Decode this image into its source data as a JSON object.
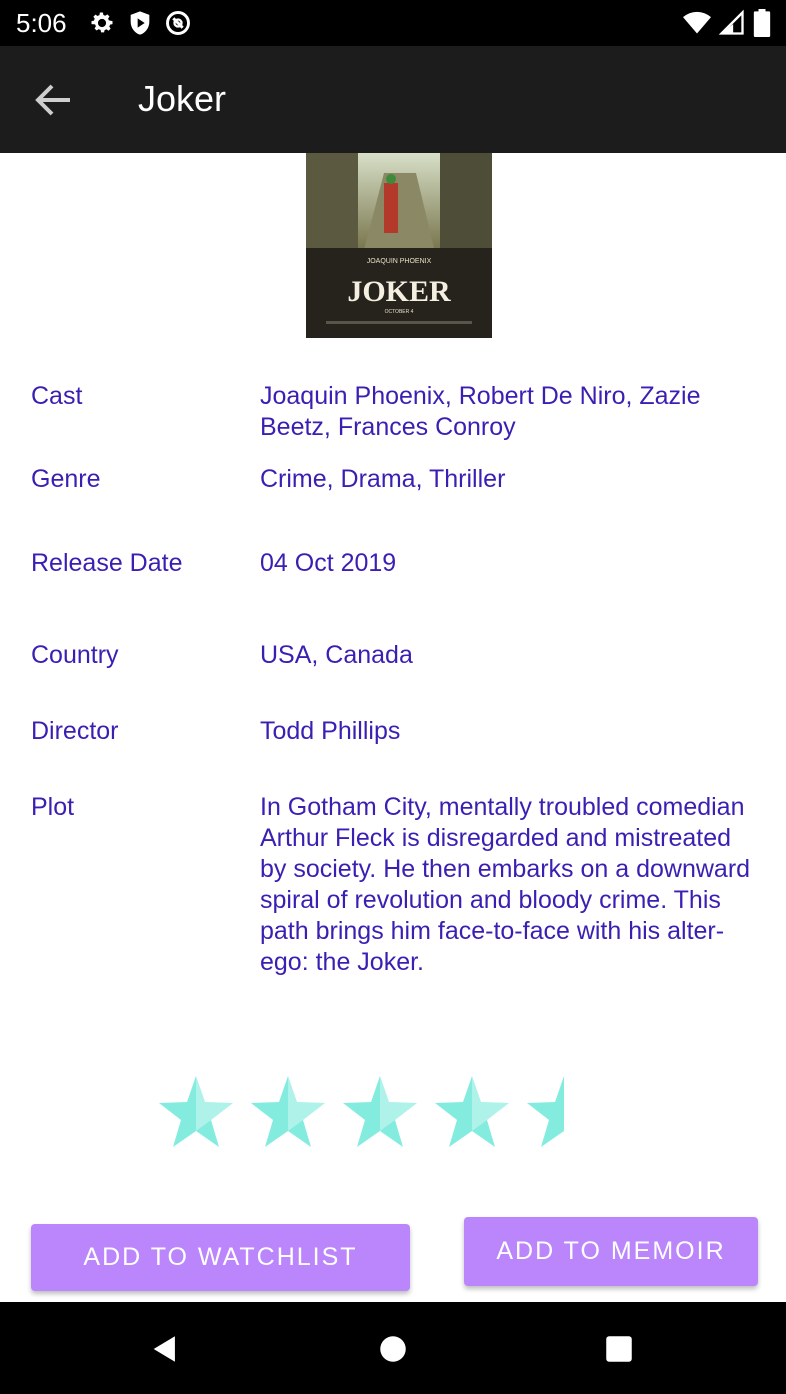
{
  "status_bar": {
    "time": "5:06"
  },
  "app_bar": {
    "title": "Joker"
  },
  "poster": {
    "actor": "JOAQUIN PHOENIX",
    "title": "JOKER",
    "date": "OCTOBER 4"
  },
  "details": [
    {
      "label": "Cast",
      "value": "Joaquin Phoenix, Robert De Niro, Zazie Beetz, Frances Conroy"
    },
    {
      "label": "Genre",
      "value": "Crime, Drama, Thriller"
    },
    {
      "label": "Release Date",
      "value": "04 Oct 2019"
    },
    {
      "label": "Country",
      "value": "USA, Canada"
    },
    {
      "label": "Director",
      "value": "Todd Phillips"
    },
    {
      "label": "Plot",
      "value": "In Gotham City, mentally troubled comedian Arthur Fleck is disregarded and mistreated by society. He then embarks on a downward spiral of revolution and bloody crime. This path brings him face-to-face with his alter-ego: the Joker."
    }
  ],
  "rating": {
    "value": 4.5,
    "max": 5,
    "color": "#84ecdf"
  },
  "buttons": {
    "watchlist": "ADD TO WATCHLIST",
    "memoir": "ADD TO MEMOIR"
  },
  "colors": {
    "accent": "#bb86fc",
    "text": "#3b1fb3",
    "app_bar": "#1c1c1c"
  }
}
